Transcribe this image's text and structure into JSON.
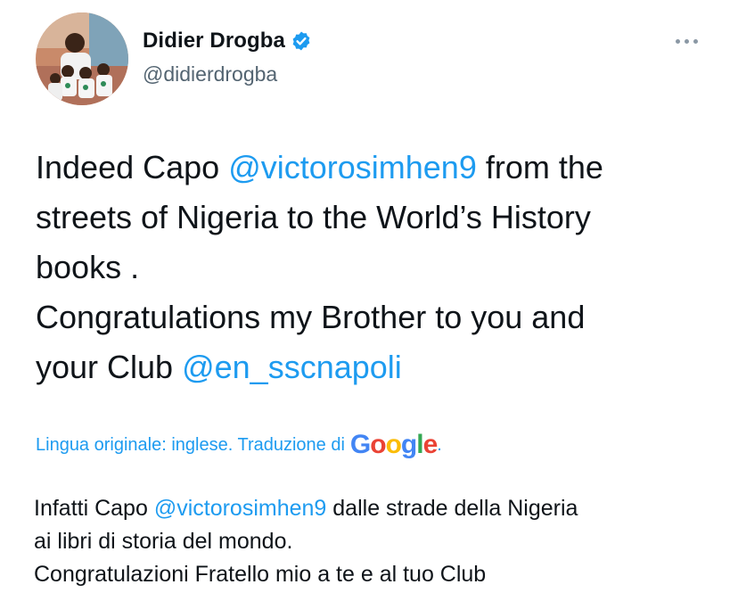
{
  "author": {
    "display_name": "Didier Drogba",
    "handle": "@didierdrogba",
    "verified": true
  },
  "tweet": {
    "part1": "Indeed Capo ",
    "mention1": "@victorosimhen9",
    "part2": " from the\nstreets of Nigeria to the World’s History\nbooks .\nCongratulations my Brother to you and\nyour Club ",
    "mention2": "@en_sscnapoli"
  },
  "translation": {
    "label": "Lingua originale: inglese. Traduzione di ",
    "provider": "Google",
    "suffix": ".",
    "part1": "Infatti Capo ",
    "mention1": "@victorosimhen9",
    "part2": " dalle strade della Nigeria\nai libri di storia del mondo.\nCongratulazioni Fratello mio a te e al tuo Club"
  },
  "icons": {
    "avatar": "profile-photo",
    "verified": "verified-badge-icon",
    "more": "more-options-icon"
  },
  "colors": {
    "link": "#1d9bf0",
    "text": "#0f1419",
    "secondary": "#536471",
    "verified": "#1d9bf0"
  }
}
